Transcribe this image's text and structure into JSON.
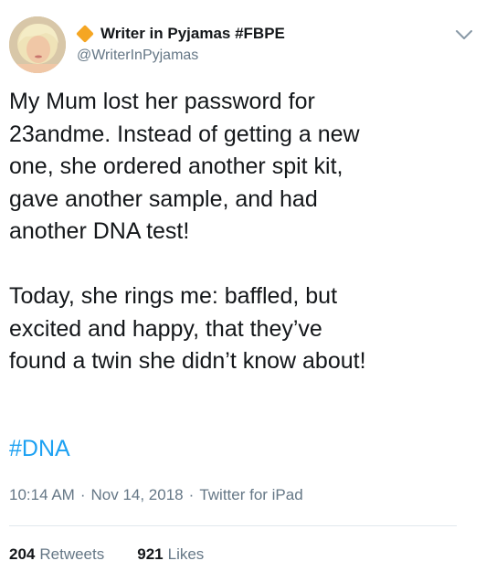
{
  "author": {
    "name": "Writer in Pyjamas #FBPE",
    "handle": "@WriterInPyjamas",
    "badge_color": "#f5a623",
    "avatar_icon": "user-avatar"
  },
  "menu_icon": "chevron-down-icon",
  "tweet": {
    "paragraph_1": "My Mum lost her password for\n23andme. Instead of getting a new\none, she ordered another spit kit,\ngave another sample, and had\nanother DNA test!",
    "paragraph_2": "Today, she rings me: baffled, but\nexcited and happy, that they’ve\nfound a twin she didn’t know about!",
    "hashtag": "#DNA"
  },
  "meta": {
    "time": "10:14 AM",
    "date": "Nov 14, 2018",
    "source": "Twitter for iPad",
    "separator": "·"
  },
  "stats": {
    "retweets_count": "204",
    "retweets_label": "Retweets",
    "likes_count": "921",
    "likes_label": "Likes"
  },
  "colors": {
    "link": "#1da1f2",
    "secondary_text": "#657786",
    "primary_text": "#14171a"
  }
}
